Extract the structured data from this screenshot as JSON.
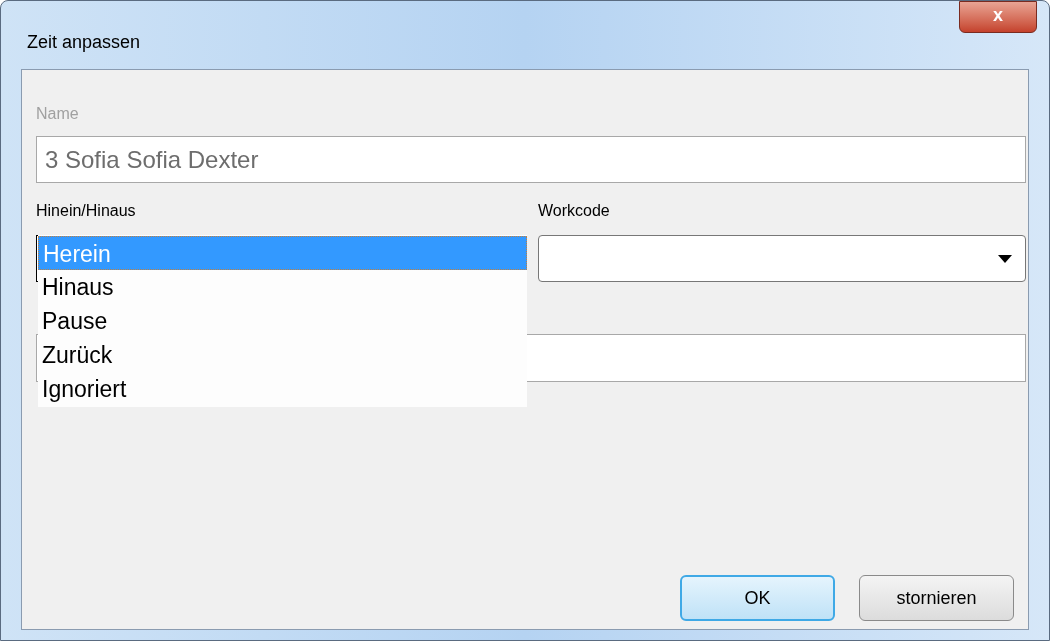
{
  "window": {
    "title": "Zeit anpassen",
    "close": "x"
  },
  "name": {
    "label": "Name",
    "value": "3 Sofia Sofia Dexter",
    "disabled": true
  },
  "direction": {
    "label": "Hinein/Hinaus",
    "expanded": true,
    "options": [
      {
        "label": "Herein",
        "selected": true
      },
      {
        "label": "Hinaus",
        "selected": false
      },
      {
        "label": "Pause",
        "selected": false
      },
      {
        "label": "Zurück",
        "selected": false
      },
      {
        "label": "Ignoriert",
        "selected": false
      }
    ]
  },
  "workcode": {
    "label": "Workcode"
  },
  "buttons": [
    {
      "label": "OK",
      "default": true
    },
    {
      "label": "stornieren",
      "default": false
    }
  ]
}
